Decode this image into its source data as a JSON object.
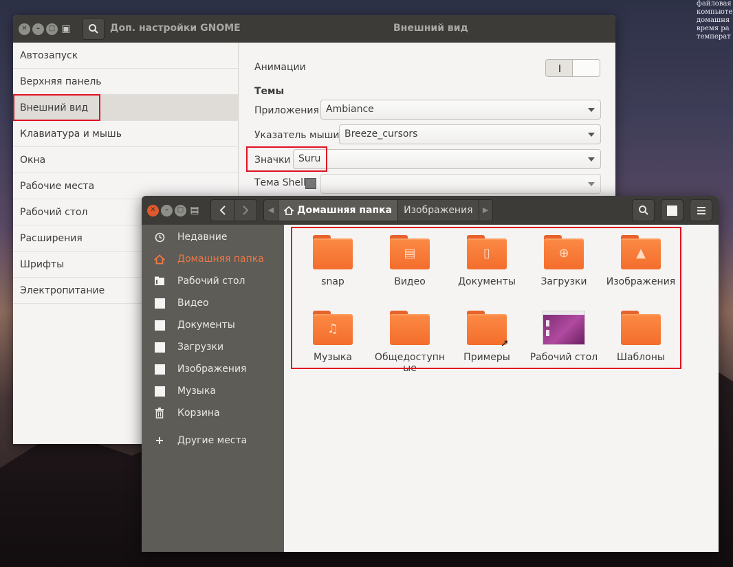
{
  "desktop": {
    "corner_text": [
      "файловая",
      "компьютер",
      "домашня",
      "время ра",
      "температ"
    ]
  },
  "tweaks": {
    "app_title": "Доп. настройки GNOME",
    "page_title": "Внешний вид",
    "sidebar": [
      {
        "label": "Автозапуск"
      },
      {
        "label": "Верхняя панель"
      },
      {
        "label": "Внешний вид"
      },
      {
        "label": "Клавиатура и мышь"
      },
      {
        "label": "Окна"
      },
      {
        "label": "Рабочие места"
      },
      {
        "label": "Рабочий стол"
      },
      {
        "label": "Расширения"
      },
      {
        "label": "Шрифты"
      },
      {
        "label": "Электропитание"
      }
    ],
    "active_item": "Внешний вид",
    "animations_label": "Анимации",
    "animations_enabled": false,
    "themes_heading": "Темы",
    "applications_label": "Приложения",
    "applications_value": "Ambiance",
    "cursor_label": "Указатель мыши",
    "cursor_value": "Breeze_cursors",
    "icons_label": "Значки",
    "icons_value": "Suru",
    "shell_label": "Тема Shell",
    "shell_value": ""
  },
  "files": {
    "path": [
      {
        "label": "Домашняя папка",
        "current": true
      },
      {
        "label": "Изображения",
        "current": false
      }
    ],
    "places": [
      {
        "label": "Недавние",
        "icon": "clock-icon"
      },
      {
        "label": "Домашняя папка",
        "icon": "home-icon",
        "active": true
      },
      {
        "label": "Рабочий стол",
        "icon": "desktop-folder-icon"
      },
      {
        "label": "Видео",
        "icon": "square-icon"
      },
      {
        "label": "Документы",
        "icon": "square-icon"
      },
      {
        "label": "Загрузки",
        "icon": "square-icon"
      },
      {
        "label": "Изображения",
        "icon": "square-icon"
      },
      {
        "label": "Музыка",
        "icon": "square-icon"
      },
      {
        "label": "Корзина",
        "icon": "trash-icon"
      },
      {
        "label": "Другие места",
        "icon": "plus-icon"
      }
    ],
    "items": [
      {
        "name": "snap",
        "icon": "folder-icon"
      },
      {
        "name": "Видео",
        "icon": "video-folder-icon"
      },
      {
        "name": "Документы",
        "icon": "documents-folder-icon"
      },
      {
        "name": "Загрузки",
        "icon": "downloads-folder-icon"
      },
      {
        "name": "Изображения",
        "icon": "pictures-folder-icon"
      },
      {
        "name": "Музыка",
        "icon": "music-folder-icon"
      },
      {
        "name": "Общедоступные",
        "icon": "public-folder-icon"
      },
      {
        "name": "Примеры",
        "icon": "examples-link-folder-icon"
      },
      {
        "name": "Рабочий стол",
        "icon": "desktop-icon"
      },
      {
        "name": "Шаблоны",
        "icon": "templates-folder-icon"
      }
    ]
  },
  "colors": {
    "accent": "#f07746",
    "highlight_box": "#e01020",
    "titlebar": "#3c3b37"
  }
}
